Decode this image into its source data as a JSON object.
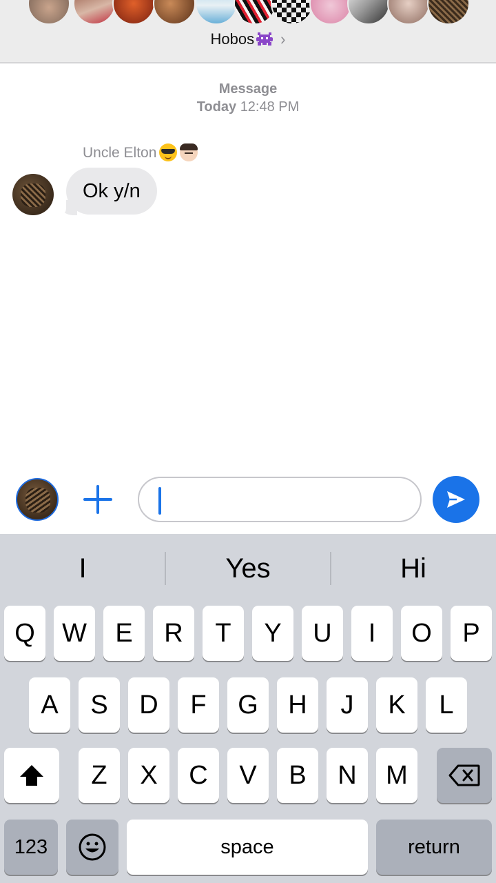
{
  "header": {
    "group_name": "Hobos",
    "chevron": "›"
  },
  "conversation": {
    "service": "Message",
    "time_day": "Today",
    "time": "12:48 PM",
    "sender": "Uncle Elton",
    "message": "Ok y/n"
  },
  "compose": {
    "value": "",
    "placeholder": ""
  },
  "keyboard": {
    "suggestions": [
      "I",
      "Yes",
      "Hi"
    ],
    "row1": [
      "Q",
      "W",
      "E",
      "R",
      "T",
      "Y",
      "U",
      "I",
      "O",
      "P"
    ],
    "row2": [
      "A",
      "S",
      "D",
      "F",
      "G",
      "H",
      "J",
      "K",
      "L"
    ],
    "row3": [
      "Z",
      "X",
      "C",
      "V",
      "B",
      "N",
      "M"
    ],
    "numbers_label": "123",
    "space_label": "space",
    "return_label": "return"
  },
  "colors": {
    "accent": "#1a73e8",
    "bubble": "#e9e9eb",
    "keyboard_bg": "#d2d5db",
    "header_bg": "#ececec"
  },
  "icons": [
    "alien-monster-icon",
    "chevron-right-icon",
    "sunglasses-emoji-icon",
    "man-emoji-icon",
    "plus-icon",
    "send-arrow-icon",
    "shift-icon",
    "emoji-icon",
    "backspace-icon"
  ]
}
